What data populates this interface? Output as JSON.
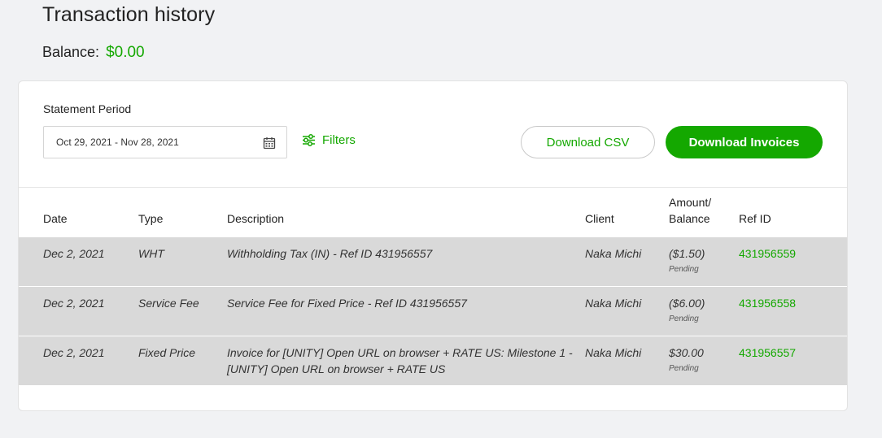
{
  "header": {
    "title": "Transaction history",
    "balance_label": "Balance:",
    "balance_value": "$0.00"
  },
  "controls": {
    "period_label": "Statement Period",
    "date_range": "Oct 29, 2021 - Nov 28, 2021",
    "filters_label": "Filters",
    "download_csv_label": "Download CSV",
    "download_invoices_label": "Download Invoices"
  },
  "table": {
    "columns": [
      "Date",
      "Type",
      "Description",
      "Client",
      "Amount/",
      "Balance",
      "Ref ID"
    ],
    "rows": [
      {
        "date": "Dec 2, 2021",
        "type": "WHT",
        "description": "Withholding Tax (IN) - Ref ID 431956557",
        "client": "Naka Michi",
        "amount": "($1.50)",
        "status": "Pending",
        "ref_id": "431956559"
      },
      {
        "date": "Dec 2, 2021",
        "type": "Service Fee",
        "description": "Service Fee for Fixed Price - Ref ID 431956557",
        "client": "Naka Michi",
        "amount": "($6.00)",
        "status": "Pending",
        "ref_id": "431956558"
      },
      {
        "date": "Dec 2, 2021",
        "type": "Fixed Price",
        "description": "Invoice for [UNITY] Open URL on browser + RATE US: Milestone 1 - [UNITY] Open URL on browser + RATE US",
        "client": "Naka Michi",
        "amount": "$30.00",
        "status": "Pending",
        "ref_id": "431956557"
      }
    ]
  },
  "icons": {
    "calendar": "calendar-icon",
    "filters": "sliders-icon"
  },
  "colors": {
    "accent": "#14a800",
    "row_bg": "#d9d9d9",
    "page_bg": "#f1f2f4"
  }
}
